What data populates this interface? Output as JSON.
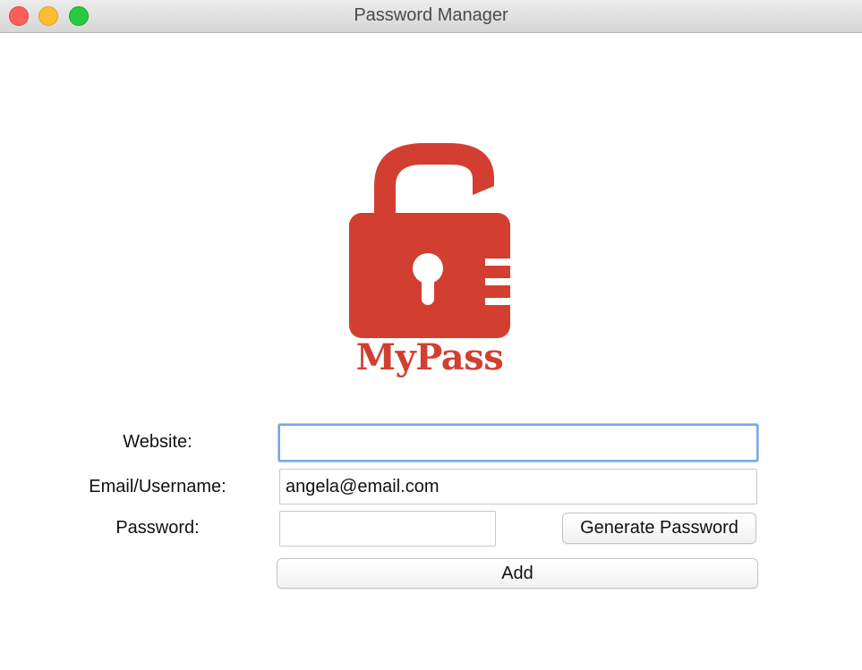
{
  "window": {
    "title": "Password Manager"
  },
  "logo": {
    "text": "MyPass",
    "color": "#d23f31",
    "icon": "unlocked-padlock-icon"
  },
  "form": {
    "website": {
      "label": "Website:",
      "value": ""
    },
    "email": {
      "label": "Email/Username:",
      "value": "angela@email.com"
    },
    "password": {
      "label": "Password:",
      "value": ""
    },
    "generate_button": "Generate Password",
    "add_button": "Add"
  }
}
